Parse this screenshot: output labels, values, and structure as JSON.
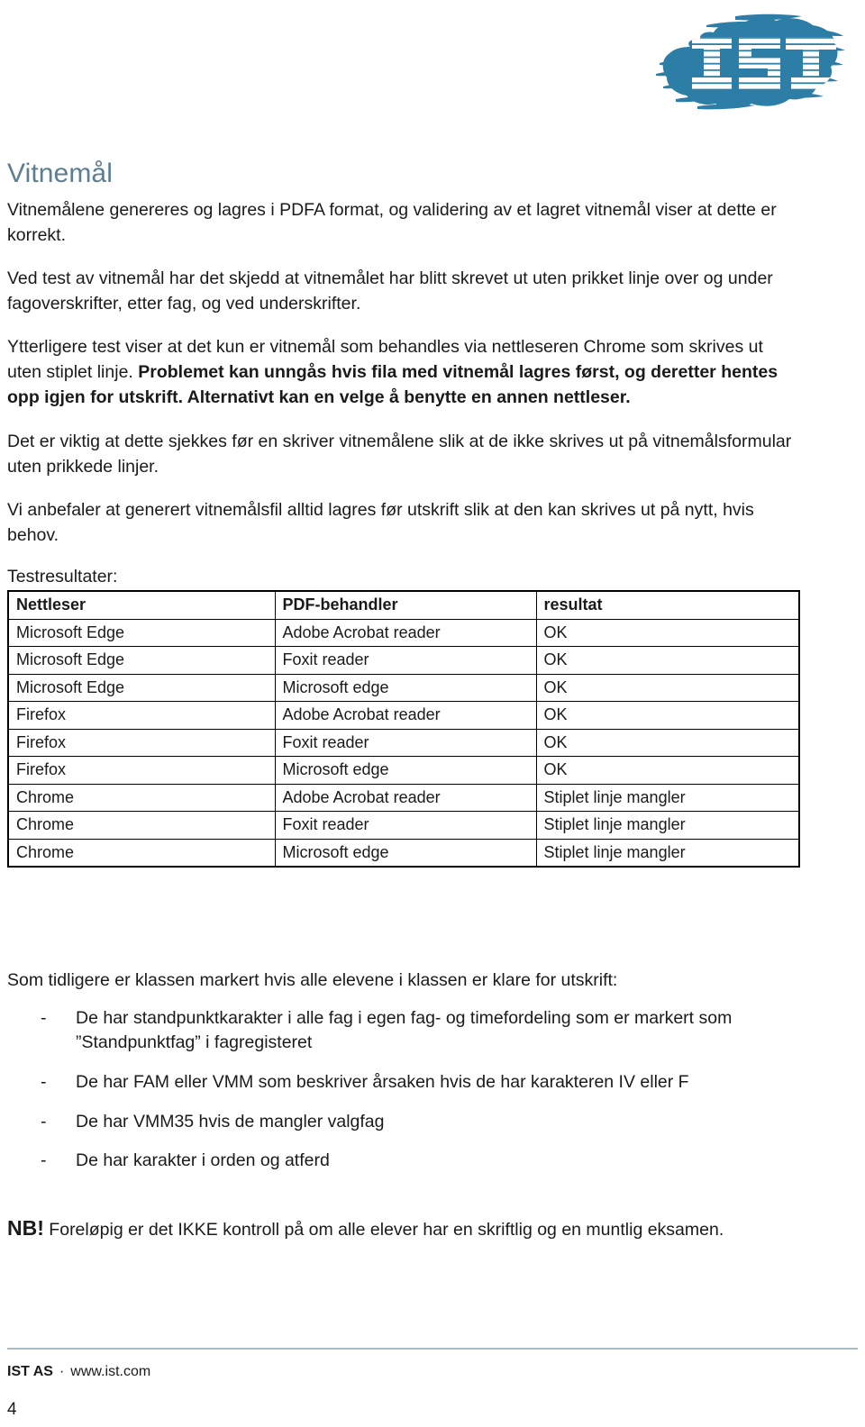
{
  "header": {
    "logo_alt": "IST",
    "logo_text": "IST",
    "brand_color": "#2d7ea6"
  },
  "document": {
    "title": "Vitnemål",
    "title_color": "#5b7f92",
    "paragraphs": [
      {
        "id": "p1",
        "runs": [
          {
            "text": "Vitnemålene genereres og lagres i PDFA format, og validering av et lagret vitnemål viser at dette er korrekt.",
            "bold": false
          }
        ]
      },
      {
        "id": "p2",
        "runs": [
          {
            "text": "Ved test av vitnemål har det skjedd at vitnemålet har blitt skrevet ut uten prikket linje over og under fagoverskrifter, etter fag,  og ved underskrifter.",
            "bold": false
          }
        ]
      },
      {
        "id": "p3",
        "runs": [
          {
            "text": "Ytterligere test viser at det kun er vitnemål som behandles via nettleseren Chrome som skrives ut uten stiplet linje.  ",
            "bold": false
          },
          {
            "text": "Problemet kan unngås hvis fila med vitnemål lagres først, og deretter hentes opp igjen for utskrift. Alternativt kan en velge å benytte en annen nettleser.",
            "bold": true
          }
        ]
      },
      {
        "id": "p4",
        "runs": [
          {
            "text": "Det er viktig at dette sjekkes før en skriver vitnemålene slik at de ikke skrives ut på vitnemålsformular uten prikkede linjer.",
            "bold": false
          }
        ]
      },
      {
        "id": "p5",
        "runs": [
          {
            "text": "Vi anbefaler at generert vitnemålsfil alltid lagres før utskrift slik at den kan skrives ut på nytt, hvis behov.",
            "bold": false
          }
        ]
      }
    ]
  },
  "results_table": {
    "label": "Testresultater:",
    "columns": [
      "Nettleser",
      "PDF-behandler",
      "resultat"
    ],
    "rows": [
      [
        "Microsoft Edge",
        "Adobe Acrobat reader",
        "OK"
      ],
      [
        "Microsoft Edge",
        "Foxit reader",
        "OK"
      ],
      [
        "Microsoft Edge",
        "Microsoft edge",
        "OK"
      ],
      [
        "Firefox",
        "Adobe Acrobat reader",
        "OK"
      ],
      [
        "Firefox",
        "Foxit reader",
        "OK"
      ],
      [
        "Firefox",
        "Microsoft edge",
        "OK"
      ],
      [
        "Chrome",
        "Adobe Acrobat reader",
        "Stiplet linje mangler"
      ],
      [
        "Chrome",
        "Foxit reader",
        "Stiplet linje mangler"
      ],
      [
        "Chrome",
        "Microsoft edge",
        "Stiplet linje mangler"
      ]
    ]
  },
  "closing": {
    "lead": "Som tidligere er klassen markert hvis alle elevene i klassen er klare for utskrift:",
    "bullet_marker": "-",
    "bullets": [
      "De har standpunktkarakter i alle fag i egen fag- og timefordeling som er markert som ”Standpunktfag” i fagregisteret",
      "De har FAM eller VMM som beskriver årsaken hvis de har karakteren IV eller F",
      "De har VMM35 hvis de mangler valgfag",
      "De har karakter i orden og atferd"
    ],
    "note_mark": "NB!",
    "note_text": " Foreløpig er det IKKE kontroll på om alle elever har en skriftlig og en muntlig eksamen."
  },
  "footer": {
    "company": "IST AS",
    "separator": "·",
    "website": "www.ist.com",
    "page_number": "4",
    "rule_color": "#a7bcc7"
  }
}
